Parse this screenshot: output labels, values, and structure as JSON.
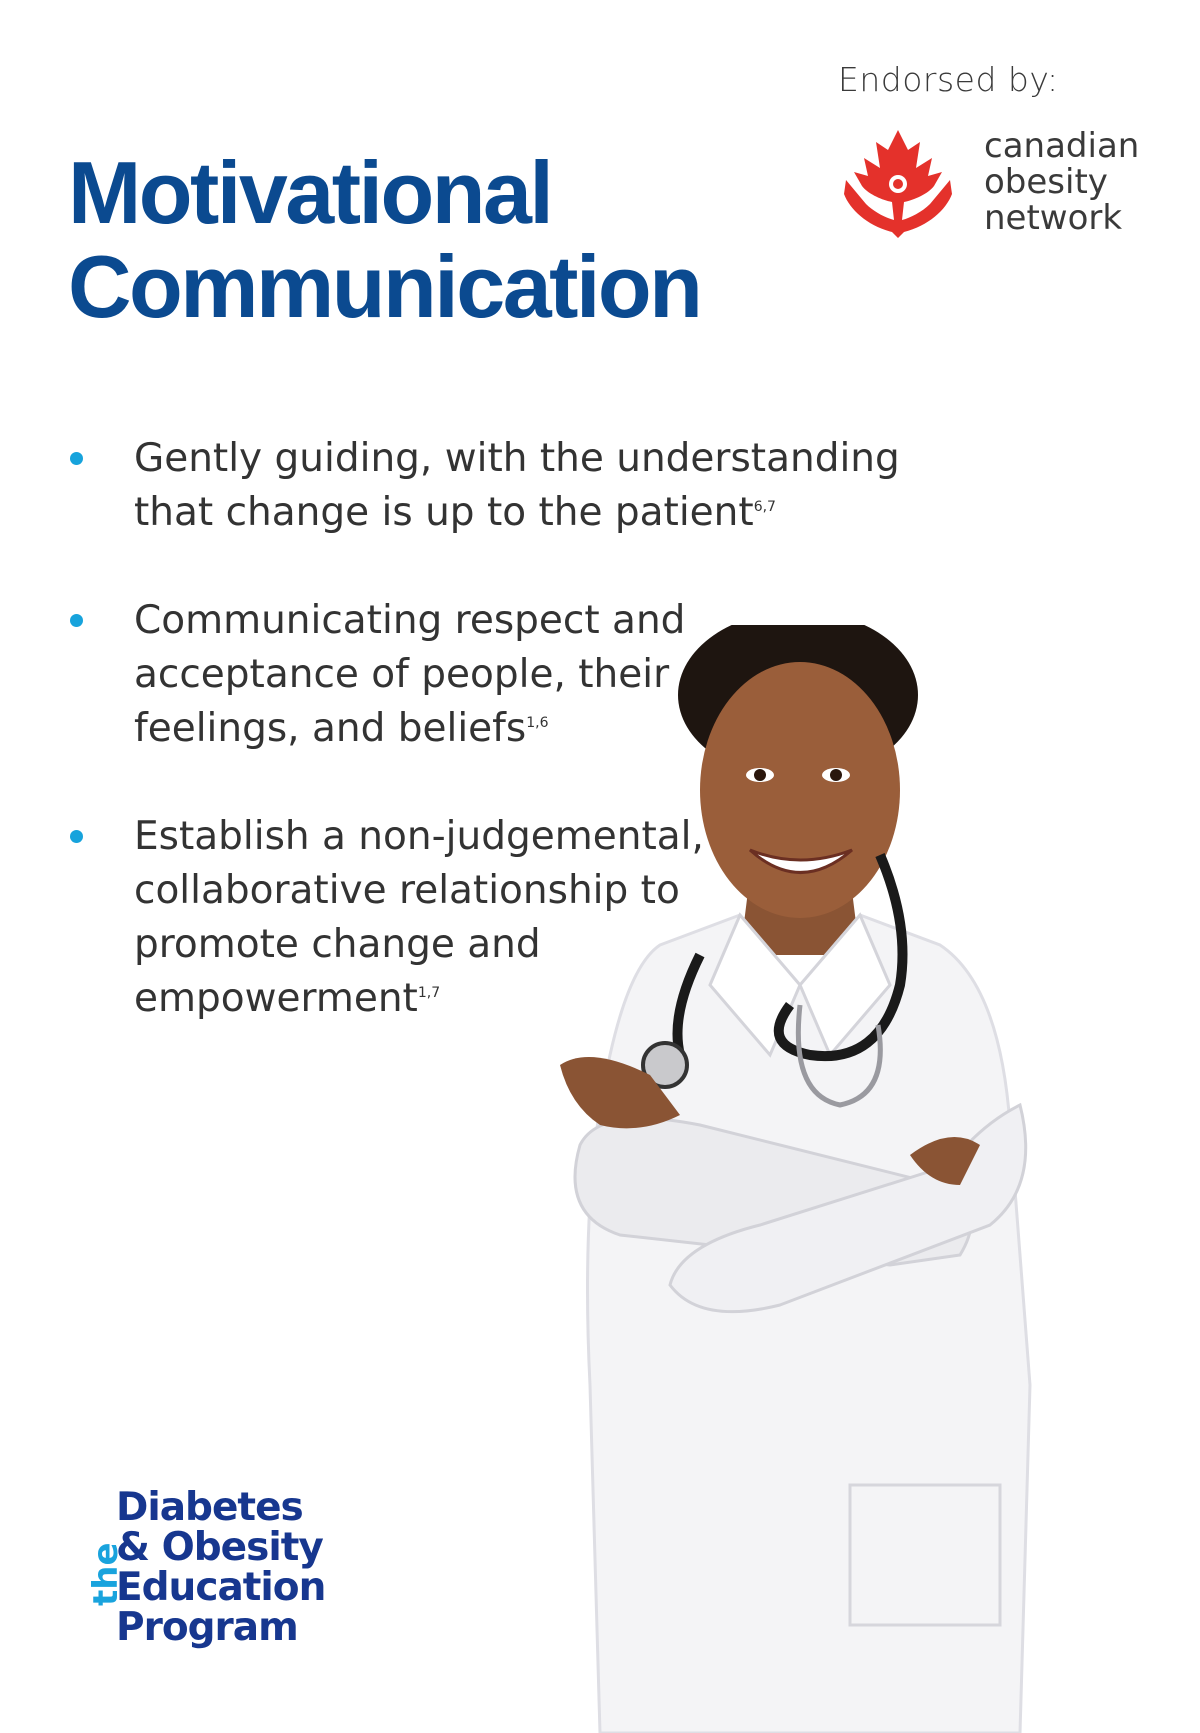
{
  "endorsement": {
    "label": "Endorsed by:",
    "organization": {
      "lines": [
        "canadian",
        "obesity",
        "network"
      ],
      "leaf_color": "#e4312b"
    }
  },
  "title": {
    "line1": "Motivational",
    "line2": "Communication",
    "color": "#0b4a90"
  },
  "bullets": [
    {
      "text": "Gently guiding, with the understanding\nthat change is up to the patient",
      "ref": "6,7"
    },
    {
      "text": "Communicating respect and\nacceptance of people, their\nfeelings, and beliefs",
      "ref": "1,6"
    },
    {
      "text": "Establish a non-judgemental,\ncollaborative relationship to\npromote change and\nempowerment",
      "ref": "1,7"
    }
  ],
  "image": {
    "subject": "smiling-doctor-with-stethoscope"
  },
  "program_logo": {
    "the": "the",
    "lines": [
      "Diabetes",
      "& Obesity",
      "Education",
      "Program"
    ],
    "color": "#17378f",
    "accent": "#19a3dd"
  }
}
